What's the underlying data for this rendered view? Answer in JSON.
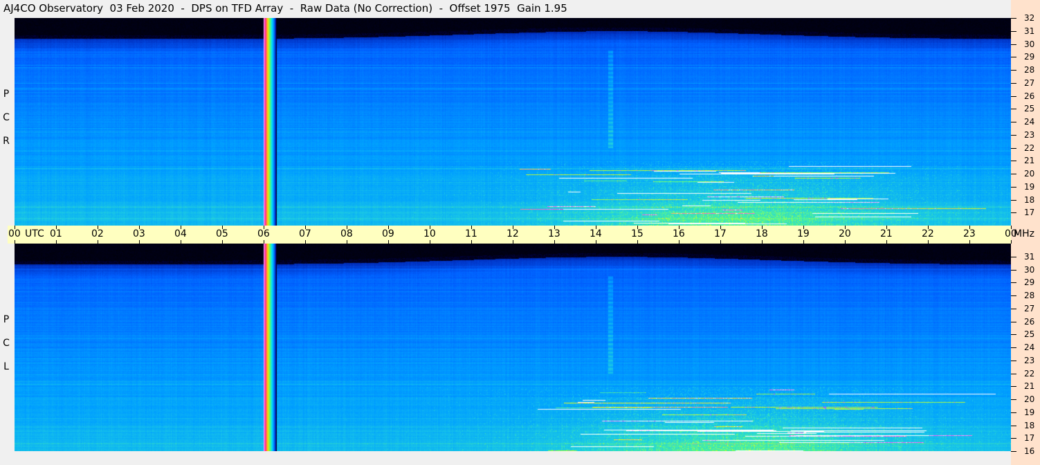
{
  "title": "AJ4CO Observatory  03 Feb 2020  -  DPS on TFD Array  -  Raw Data (No Correction)  -  Offset 1975  Gain 1.95",
  "chart_data": {
    "type": "heatmap",
    "title": "AJ4CO Observatory 03 Feb 2020 - DPS on TFD Array - Raw Data (No Correction) - Offset 1975 Gain 1.95",
    "xlabel": "UTC",
    "ylabel": "MHz",
    "x_unit": "UTC",
    "y_unit": "MHz",
    "xlim": [
      0,
      24
    ],
    "ylim": [
      16,
      32
    ],
    "x_ticks": [
      "00",
      "01",
      "02",
      "03",
      "04",
      "05",
      "06",
      "07",
      "08",
      "09",
      "10",
      "11",
      "12",
      "13",
      "14",
      "15",
      "16",
      "17",
      "18",
      "19",
      "20",
      "21",
      "22",
      "23",
      "00"
    ],
    "y_ticks": [
      "16",
      "17",
      "18",
      "19",
      "20",
      "21",
      "22",
      "23",
      "24",
      "25",
      "26",
      "27",
      "28",
      "29",
      "30",
      "31",
      "32"
    ],
    "panels": [
      {
        "name": "RCP",
        "label": [
          "R",
          "C",
          "P"
        ]
      },
      {
        "name": "LCP",
        "label": [
          "L",
          "C",
          "P"
        ]
      }
    ],
    "features": {
      "broadband_interference_utc": [
        6.0,
        6.3
      ],
      "vertical_stripe_utc": 14.35,
      "vertical_stripe_mhz": [
        22,
        29.5
      ],
      "enhanced_band_utc": [
        12,
        23.5
      ],
      "enhanced_band_mhz": [
        16,
        19
      ],
      "upper_cutoff_mhz": [
        30.4,
        31.0
      ]
    },
    "colormap": [
      "#000000",
      "#000040",
      "#0030c0",
      "#0060ff",
      "#00a0ff",
      "#20d0e0",
      "#60ff80",
      "#ffff00",
      "#ff40ff",
      "#ffffff"
    ]
  }
}
